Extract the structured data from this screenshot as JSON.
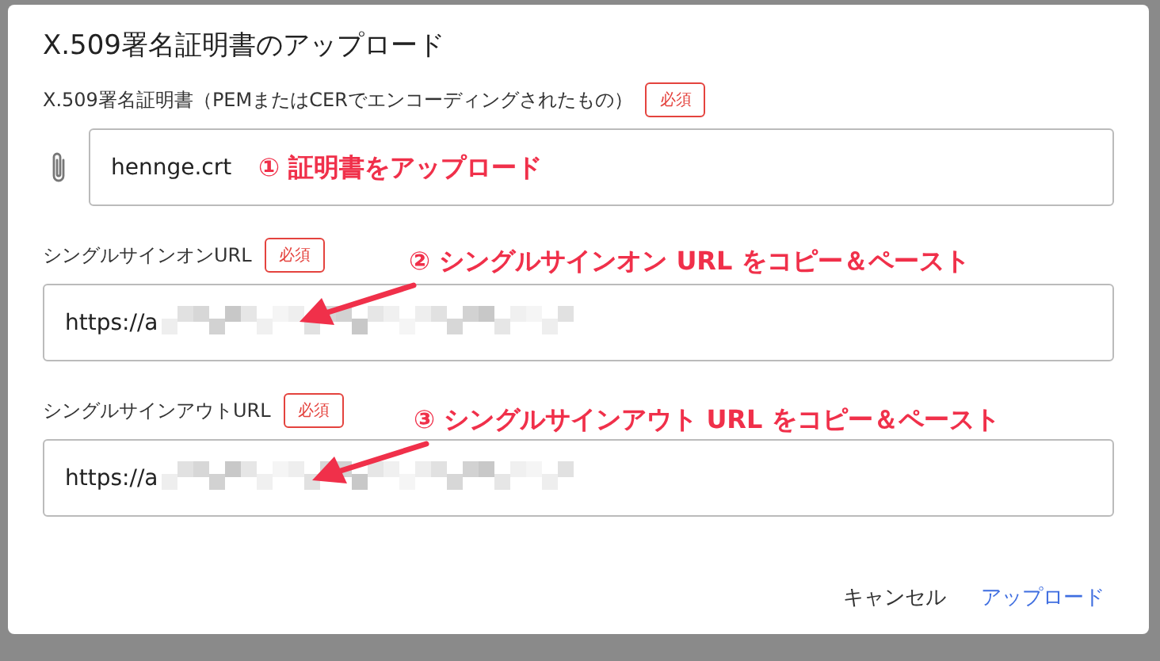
{
  "dialog": {
    "title": "X.509署名証明書のアップロード",
    "fields": [
      {
        "kind": "file",
        "label": "X.509署名証明書（PEMまたはCERでエンコーディングされたもの）",
        "required_tag": "必須",
        "value": "hennge.crt",
        "redacted": false
      },
      {
        "kind": "text",
        "label": "シングルサインオンURL",
        "required_tag": "必須",
        "value": "https://a",
        "redacted": true
      },
      {
        "kind": "text",
        "label": "シングルサインアウトURL",
        "required_tag": "必須",
        "value": "https://a",
        "redacted": true
      }
    ],
    "buttons": [
      {
        "label": "キャンセル",
        "primary": false
      },
      {
        "label": "アップロード",
        "primary": true
      }
    ]
  },
  "annotations": [
    {
      "text": "① 証明書をアップロード",
      "arrow": false
    },
    {
      "text": "② シングルサインオン URL をコピー＆ペースト",
      "arrow": true
    },
    {
      "text": "③ シングルサインアウト URL をコピー＆ペースト",
      "arrow": true
    }
  ]
}
